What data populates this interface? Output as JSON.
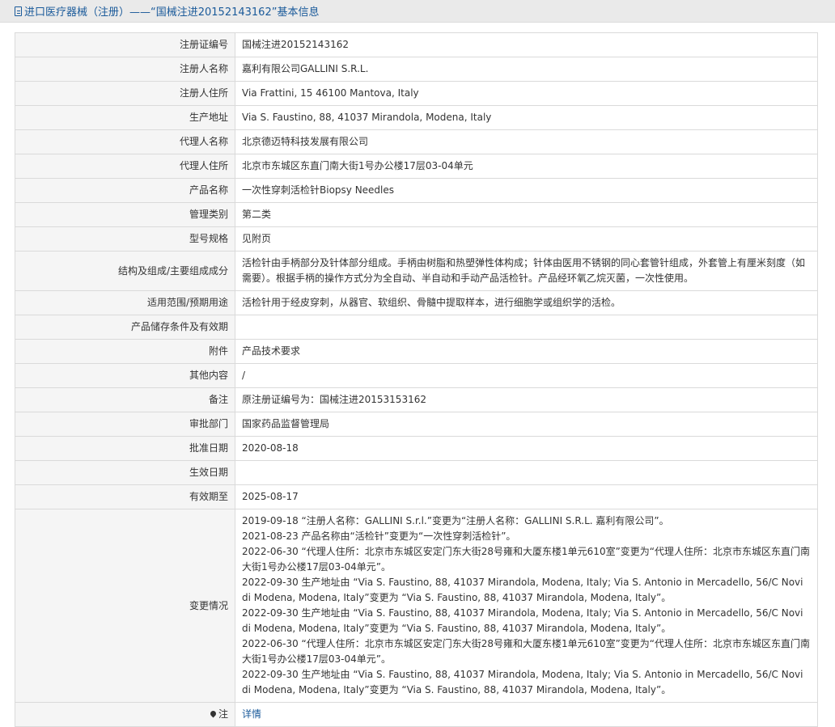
{
  "header": {
    "title": "进口医疗器械（注册）——“国械注进20152143162”基本信息"
  },
  "rows": [
    {
      "label": "注册证编号",
      "value": "国械注进20152143162"
    },
    {
      "label": "注册人名称",
      "value": "嘉利有限公司GALLINI S.R.L."
    },
    {
      "label": "注册人住所",
      "value": "Via Frattini, 15 46100 Mantova, Italy"
    },
    {
      "label": "生产地址",
      "value": "Via S. Faustino, 88, 41037 Mirandola, Modena, Italy"
    },
    {
      "label": "代理人名称",
      "value": "北京德迈特科技发展有限公司"
    },
    {
      "label": "代理人住所",
      "value": "北京市东城区东直门南大街1号办公楼17层03-04单元"
    },
    {
      "label": "产品名称",
      "value": "一次性穿刺活检针Biopsy Needles"
    },
    {
      "label": "管理类别",
      "value": "第二类"
    },
    {
      "label": "型号规格",
      "value": "见附页"
    },
    {
      "label": "结构及组成/主要组成成分",
      "value": "活检针由手柄部分及针体部分组成。手柄由树脂和热塑弹性体构成；针体由医用不锈钢的同心套管针组成，外套管上有厘米刻度（如需要）。根据手柄的操作方式分为全自动、半自动和手动产品活检针。产品经环氧乙烷灭菌，一次性使用。"
    },
    {
      "label": "适用范围/预期用途",
      "value": "活检针用于经皮穿刺，从器官、软组织、骨髓中提取样本，进行细胞学或组织学的活检。"
    },
    {
      "label": "产品储存条件及有效期",
      "value": ""
    },
    {
      "label": "附件",
      "value": "产品技术要求"
    },
    {
      "label": "其他内容",
      "value": "/"
    },
    {
      "label": "备注",
      "value": "原注册证编号为：国械注进20153153162"
    },
    {
      "label": "审批部门",
      "value": "国家药品监督管理局"
    },
    {
      "label": "批准日期",
      "value": "2020-08-18"
    },
    {
      "label": "生效日期",
      "value": ""
    },
    {
      "label": "有效期至",
      "value": "2025-08-17"
    }
  ],
  "changes": {
    "label": "变更情况",
    "items": [
      "2019-09-18 “注册人名称：GALLINI S.r.l.”变更为“注册人名称：GALLINI S.R.L. 嘉利有限公司”。",
      "2021-08-23 产品名称由“活检针”变更为“一次性穿刺活检针”。",
      "2022-06-30 “代理人住所：北京市东城区安定门东大街28号雍和大厦东楼1单元610室”变更为“代理人住所：北京市东城区东直门南大街1号办公楼17层03-04单元”。",
      "2022-09-30 生产地址由 “Via S. Faustino, 88, 41037 Mirandola, Modena, Italy; Via S. Antonio in Mercadello, 56/C Novi di Modena, Modena, Italy”变更为 “Via S. Faustino, 88, 41037 Mirandola, Modena, Italy”。",
      "2022-09-30 生产地址由 “Via S. Faustino, 88, 41037 Mirandola, Modena, Italy; Via S. Antonio in Mercadello, 56/C Novi di Modena, Modena, Italy”变更为 “Via S. Faustino, 88, 41037 Mirandola, Modena, Italy”。",
      "2022-06-30 “代理人住所：北京市东城区安定门东大街28号雍和大厦东楼1单元610室”变更为“代理人住所：北京市东城区东直门南大街1号办公楼17层03-04单元”。",
      "2022-09-30 生产地址由 “Via S. Faustino, 88, 41037 Mirandola, Modena, Italy; Via S. Antonio in Mercadello, 56/C Novi di Modena, Modena, Italy”变更为 “Via S. Faustino, 88, 41037 Mirandola, Modena, Italy”。"
    ]
  },
  "note": {
    "label": "注",
    "link_label": "详情",
    "icon": "pin-icon"
  },
  "colors": {
    "link": "#1a5a9a",
    "label_bg": "#f5f5f5",
    "border": "#dadada",
    "header_bg": "#eaeaea"
  }
}
